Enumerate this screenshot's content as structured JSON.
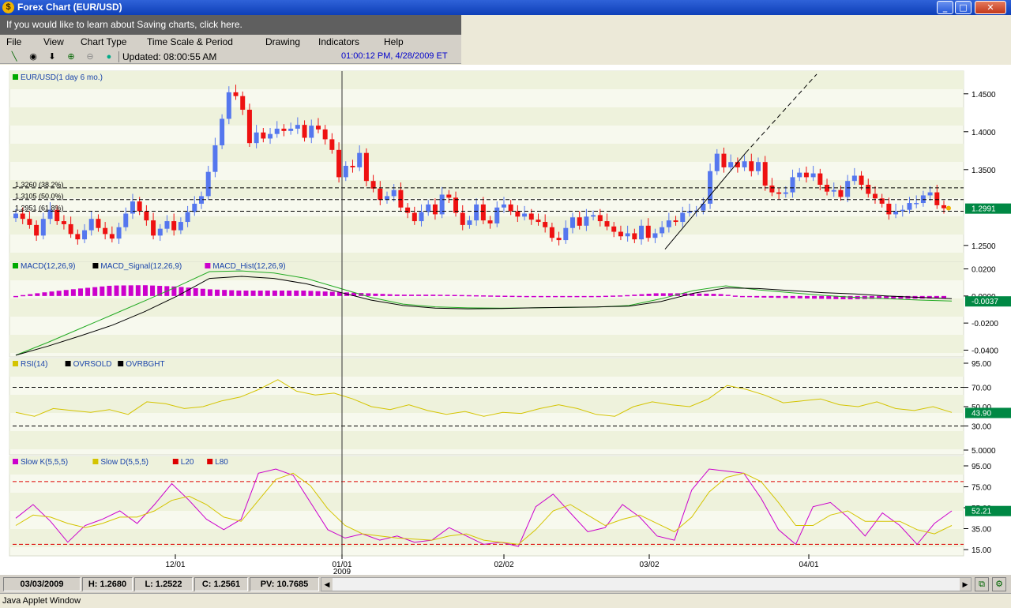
{
  "window": {
    "title": "Forex Chart (EUR/USD)",
    "controls": {
      "minimize": "_",
      "maximize": "□",
      "close": "✕"
    }
  },
  "infobar": {
    "text": "If you would like to learn about Saving charts, click here."
  },
  "menu": [
    "File",
    "View",
    "Chart Type",
    "Time Scale & Period",
    "Drawing",
    "Indicators",
    "Help"
  ],
  "toolbar": {
    "icons": [
      "line-tool-icon",
      "crosshair-icon",
      "arrow-down-icon",
      "zoom-in-icon",
      "zoom-out-icon",
      "globe-icon"
    ],
    "updated": "Updated: 08:00:55 AM",
    "clock": "01:00:12 PM, 4/28/2009 ET"
  },
  "panels": {
    "price": {
      "legend": [
        {
          "label": "EUR/USD(1 day 6 mo.)",
          "color": "#00aa00"
        }
      ],
      "ticks": [
        "1.4500",
        "1.4000",
        "1.3500",
        "1.2500"
      ],
      "current": "1.2991",
      "fib": [
        "1.3260 (38.2%)",
        "1.3105 (50.0%)",
        "1.2951 (61.8%)"
      ]
    },
    "macd": {
      "legend": [
        {
          "label": "MACD(12,26,9)",
          "color": "#00aa00"
        },
        {
          "label": "MACD_Signal(12,26,9)",
          "color": "#000000"
        },
        {
          "label": "MACD_Hist(12,26,9)",
          "color": "#cc00cc"
        }
      ],
      "ticks": [
        "0.0200",
        "0.0000",
        "-0.0200",
        "-0.0400"
      ],
      "current": "-0.0037"
    },
    "rsi": {
      "legend": [
        {
          "label": "RSI(14)",
          "color": "#d4c400"
        },
        {
          "label": "OVRSOLD",
          "color": "#000000"
        },
        {
          "label": "OVRBGHT",
          "color": "#000000"
        }
      ],
      "ticks": [
        "95.00",
        "70.00",
        "50.00",
        "30.00",
        "5.0000"
      ],
      "current": "43.90"
    },
    "stoch": {
      "legend": [
        {
          "label": "Slow K(5,5,5)",
          "color": "#cc00cc"
        },
        {
          "label": "Slow D(5,5,5)",
          "color": "#d4c400"
        },
        {
          "label": "L20",
          "color": "#dd0000"
        },
        {
          "label": "L80",
          "color": "#dd0000"
        }
      ],
      "ticks": [
        "95.00",
        "75.00",
        "55.00",
        "35.00",
        "15.00"
      ],
      "current": "52.21"
    }
  },
  "xaxis": {
    "labels": [
      "12/01",
      "01/01",
      "02/02",
      "03/02",
      "04/01"
    ],
    "year": "2009"
  },
  "status": {
    "date": "03/03/2009",
    "high": "H: 1.2680",
    "low": "L: 1.2522",
    "close": "C: 1.2561",
    "pv": "PV: 10.7685",
    "scroll_left": "◀",
    "scroll_right": "▶"
  },
  "applet": "Java Applet Window",
  "colors": {
    "up": "#5577ee",
    "down": "#ee1111",
    "macd_hist": "#cc00cc",
    "rsi": "#d4c400",
    "value_box": "#008844"
  },
  "chart_data": [
    {
      "type": "candlestick",
      "title": "EUR/USD(1 day 6 mo.)",
      "ylim": [
        1.23,
        1.48
      ],
      "x_ticks": [
        "12/01",
        "01/01",
        "02/02",
        "03/02",
        "04/01"
      ],
      "close": [
        1.292,
        1.285,
        1.277,
        1.263,
        1.285,
        1.297,
        1.282,
        1.278,
        1.265,
        1.258,
        1.27,
        1.285,
        1.273,
        1.265,
        1.259,
        1.274,
        1.292,
        1.308,
        1.295,
        1.283,
        1.263,
        1.272,
        1.282,
        1.27,
        1.281,
        1.294,
        1.305,
        1.315,
        1.347,
        1.382,
        1.417,
        1.452,
        1.447,
        1.429,
        1.385,
        1.399,
        1.391,
        1.397,
        1.404,
        1.401,
        1.404,
        1.409,
        1.392,
        1.408,
        1.403,
        1.39,
        1.376,
        1.34,
        1.355,
        1.353,
        1.372,
        1.335,
        1.325,
        1.31,
        1.315,
        1.323,
        1.3,
        1.293,
        1.282,
        1.294,
        1.304,
        1.291,
        1.317,
        1.313,
        1.293,
        1.277,
        1.283,
        1.304,
        1.283,
        1.279,
        1.3,
        1.304,
        1.295,
        1.288,
        1.292,
        1.284,
        1.281,
        1.274,
        1.26,
        1.257,
        1.273,
        1.287,
        1.276,
        1.288,
        1.29,
        1.282,
        1.275,
        1.268,
        1.262,
        1.266,
        1.258,
        1.276,
        1.26,
        1.266,
        1.274,
        1.283,
        1.281,
        1.293,
        1.295,
        1.296,
        1.305,
        1.348,
        1.371,
        1.353,
        1.36,
        1.353,
        1.361,
        1.348,
        1.36,
        1.329,
        1.32,
        1.318,
        1.32,
        1.34,
        1.346,
        1.34,
        1.345,
        1.33,
        1.321,
        1.323,
        1.314,
        1.335,
        1.342,
        1.33,
        1.318,
        1.312,
        1.305,
        1.291,
        1.295,
        1.297,
        1.306,
        1.306,
        1.316,
        1.32,
        1.303,
        1.299
      ],
      "current": 1.2991,
      "fib_levels": [
        1.326,
        1.3105,
        1.2951
      ]
    },
    {
      "type": "line",
      "title": "MACD(12,26,9)",
      "ylim": [
        -0.045,
        0.025
      ],
      "series": [
        {
          "name": "MACD(12,26,9)",
          "values": [
            -0.0438,
            -0.0342,
            -0.024,
            -0.0138,
            -0.0035,
            0.007,
            0.018,
            0.0185,
            0.017,
            0.013,
            0.006,
            -0.001,
            -0.006,
            -0.008,
            -0.0088,
            -0.009,
            -0.0088,
            -0.0085,
            -0.0082,
            -0.007,
            -0.002,
            0.004,
            0.0075,
            0.0045,
            0.0025,
            0.0005,
            -0.001,
            -0.002,
            -0.003,
            -0.0037
          ]
        },
        {
          "name": "MACD_Signal(12,26,9)",
          "values": [
            -0.0438,
            -0.037,
            -0.0295,
            -0.0215,
            -0.0115,
            0.0,
            0.013,
            0.0145,
            0.013,
            0.009,
            0.003,
            -0.003,
            -0.007,
            -0.009,
            -0.0095,
            -0.0093,
            -0.0088,
            -0.0084,
            -0.0081,
            -0.0075,
            -0.004,
            0.002,
            0.006,
            0.0055,
            0.004,
            0.0025,
            0.0015,
            0.0,
            -0.001,
            -0.002
          ]
        },
        {
          "name": "MACD_Hist(12,26,9)",
          "values": [
            0.0,
            0.003,
            0.0055,
            0.0077,
            0.008,
            0.007,
            0.005,
            0.004,
            0.004,
            0.004,
            0.003,
            0.002,
            0.001,
            0.001,
            0.0007,
            0.0003,
            0.0,
            -0.0001,
            -0.0001,
            0.0005,
            0.002,
            0.002,
            0.0015,
            -0.001,
            -0.0015,
            -0.002,
            -0.0025,
            -0.002,
            -0.002,
            -0.0017
          ]
        }
      ],
      "current": -0.0037
    },
    {
      "type": "line",
      "title": "RSI(14)",
      "ylim": [
        5,
        95
      ],
      "series": [
        {
          "name": "RSI(14)",
          "values": [
            44,
            40,
            48,
            46,
            44,
            47,
            42,
            55,
            53,
            48,
            50,
            56,
            60,
            68,
            78,
            66,
            62,
            64,
            58,
            50,
            47,
            52,
            46,
            42,
            45,
            40,
            44,
            43,
            48,
            52,
            48,
            42,
            40,
            50,
            55,
            52,
            50,
            58,
            72,
            68,
            62,
            54,
            56,
            58,
            52,
            50,
            55,
            48,
            46,
            50,
            44
          ]
        }
      ],
      "levels": [
        30,
        70
      ],
      "current": 43.9
    },
    {
      "type": "line",
      "title": "Slow K(5,5,5)",
      "ylim": [
        15,
        95
      ],
      "series": [
        {
          "name": "Slow K(5,5,5)",
          "values": [
            45,
            58,
            42,
            22,
            38,
            44,
            52,
            40,
            58,
            78,
            62,
            44,
            34,
            44,
            88,
            92,
            86,
            60,
            34,
            26,
            30,
            24,
            28,
            22,
            24,
            36,
            28,
            20,
            22,
            18,
            56,
            68,
            50,
            32,
            36,
            58,
            46,
            28,
            24,
            72,
            92,
            90,
            88,
            64,
            34,
            20,
            56,
            60,
            46,
            28,
            50,
            38,
            20,
            40,
            52
          ]
        },
        {
          "name": "Slow D(5,5,5)",
          "values": [
            38,
            48,
            46,
            40,
            36,
            40,
            46,
            46,
            52,
            62,
            66,
            58,
            46,
            42,
            62,
            82,
            88,
            76,
            54,
            38,
            30,
            28,
            26,
            25,
            24,
            28,
            30,
            24,
            22,
            20,
            34,
            52,
            58,
            48,
            38,
            44,
            48,
            40,
            32,
            46,
            70,
            84,
            88,
            80,
            60,
            38,
            38,
            48,
            52,
            42,
            42,
            42,
            34,
            30,
            38
          ]
        }
      ],
      "levels": [
        20,
        80
      ],
      "current": 52.21
    }
  ]
}
